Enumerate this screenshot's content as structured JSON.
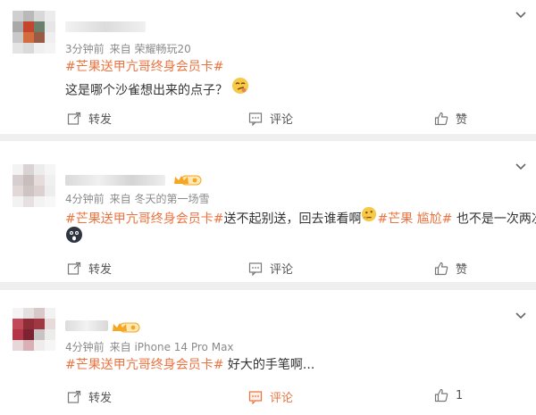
{
  "comments": [
    {
      "time": "3分钟前",
      "source": "来自 荣耀畅玩20",
      "hashtag": "#芒果送甲亢哥终身会员卡#",
      "body": "这是哪个沙雀想出来的点子？",
      "actions": {
        "repost": "转发",
        "comment": "评论",
        "like": "赞"
      }
    },
    {
      "time": "4分钟前",
      "source": "来自 冬天的第一场雪",
      "hashtag": "#芒果送甲亢哥终身会员卡#",
      "body_a": "送不起别送，回去谁看啊",
      "hashtag2": "#芒果 尴尬#",
      "body_b": " 也不是一次两次了",
      "actions": {
        "repost": "转发",
        "comment": "评论",
        "like": "赞"
      }
    },
    {
      "time": "4分钟前",
      "source": "来自 iPhone 14 Pro Max",
      "hashtag": "#芒果送甲亢哥终身会员卡#",
      "body": " 好大的手笔啊...",
      "actions": {
        "repost": "转发",
        "comment": "评论",
        "like_count": "1"
      }
    }
  ],
  "colors": {
    "tag": "#eb7340",
    "badge": "#f5a623",
    "meta": "#8a8a8a"
  },
  "icons": [
    "chevron-down-icon",
    "repost-icon",
    "comment-icon",
    "like-icon",
    "member-crown-icon"
  ]
}
